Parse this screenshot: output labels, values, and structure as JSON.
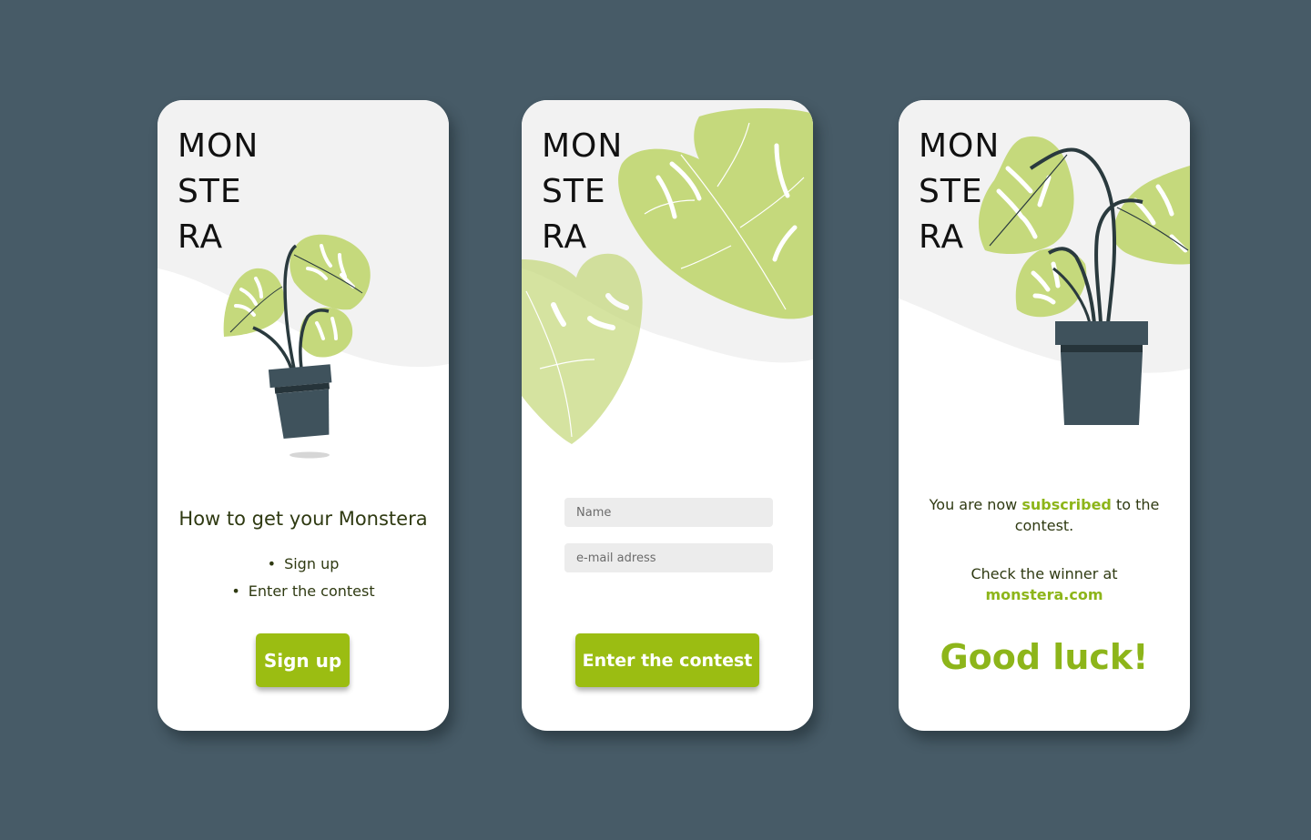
{
  "brand": {
    "logo_lines": [
      "MON",
      "STE",
      "RA"
    ]
  },
  "colors": {
    "background": "#475b67",
    "card": "#ffffff",
    "accent": "#9bbd12",
    "leaf": "#c5d97c",
    "pot": "#3f525c"
  },
  "screen1": {
    "headline": "How to get your Monstera",
    "steps": [
      "Sign up",
      "Enter the contest"
    ],
    "button_label": "Sign up"
  },
  "screen2": {
    "name_placeholder": "Name",
    "email_placeholder": "e-mail adress",
    "button_label": "Enter the contest"
  },
  "screen3": {
    "sub_prefix": "You are now ",
    "sub_highlight": "subscribed",
    "sub_suffix": " to the contest.",
    "winner_text": "Check the winner at",
    "winner_link": "monstera.com",
    "closing": "Good luck!"
  }
}
